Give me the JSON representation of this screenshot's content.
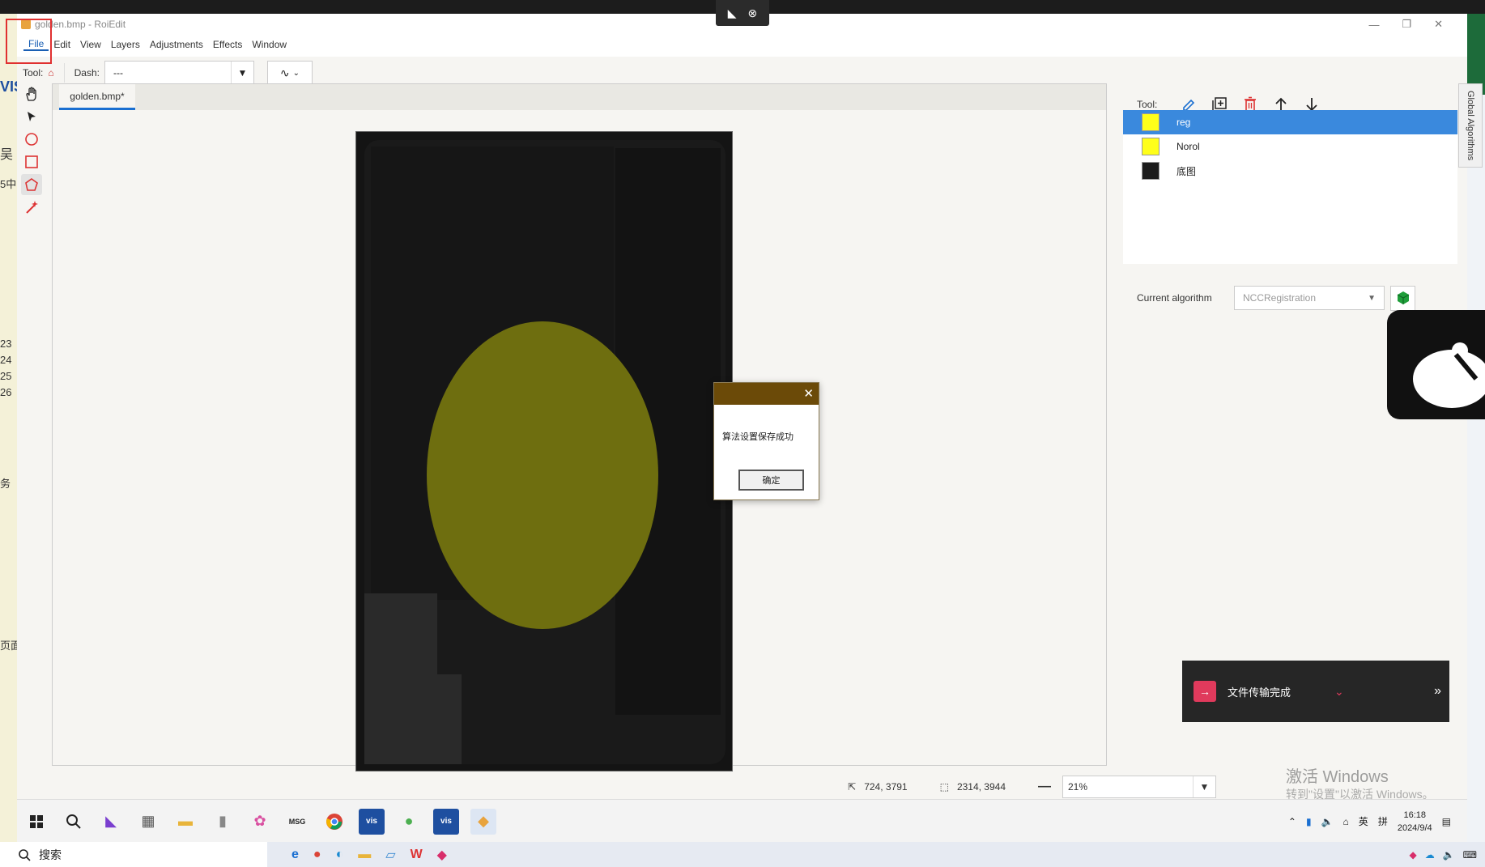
{
  "window": {
    "title": "golden.bmp - RoiEdit",
    "controls": [
      "minimize-icon",
      "restore-icon",
      "close-icon"
    ]
  },
  "menu": [
    "File",
    "Edit",
    "View",
    "Layers",
    "Adjustments",
    "Effects",
    "Window"
  ],
  "toolbar": {
    "tool_label": "Tool:",
    "dash_label": "Dash:",
    "dash_value": "---"
  },
  "tools": [
    "hand-icon",
    "pointer-icon",
    "circle-icon",
    "rectangle-icon",
    "polygon-icon",
    "magic-wand-icon"
  ],
  "document": {
    "tab_label": "golden.bmp*"
  },
  "dialog": {
    "message": "算法设置保存成功",
    "ok_label": "确定"
  },
  "layers_panel": {
    "tool_label": "Tool:",
    "layers": [
      {
        "name": "reg",
        "color": "#ffff1a",
        "selected": true
      },
      {
        "name": "Norol",
        "color": "#ffff1a",
        "selected": false
      },
      {
        "name": "底图",
        "color": "#1c1c1c",
        "selected": false
      }
    ],
    "algorithm_label": "Current algorithm",
    "algorithm_value": "NCCRegistration",
    "global_tab": "Global Algorithms"
  },
  "status": {
    "cursor": "724, 3791",
    "size": "2314, 3944",
    "zoom": "21%"
  },
  "taskbar": {
    "time": "16:18",
    "date": "2024/9/4",
    "ime": "英",
    "ime2": "拼"
  },
  "outer_taskbar": {
    "search_placeholder": "搜索"
  },
  "notification": {
    "text": "文件传输完成"
  },
  "watermark": {
    "line1": "激活 Windows",
    "line2": "转到\"设置\"以激活 Windows。"
  },
  "colors": {
    "accent": "#1a6fd1",
    "selection": "#3a89dd",
    "ellipse": "#6e6e0f",
    "dialog_header": "#6b4a08"
  }
}
